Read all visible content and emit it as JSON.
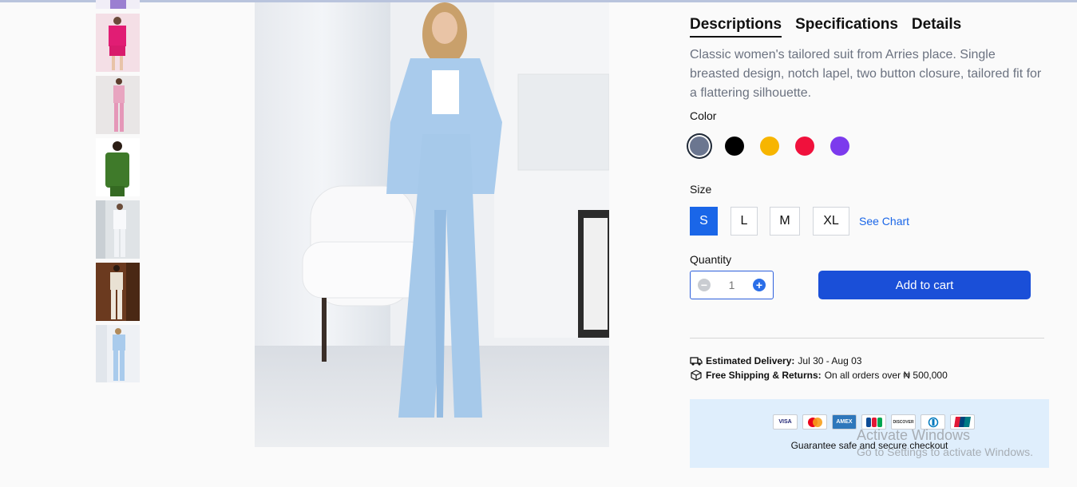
{
  "tabs": [
    {
      "label": "Descriptions",
      "active": true
    },
    {
      "label": "Specifications",
      "active": false
    },
    {
      "label": "Details",
      "active": false
    }
  ],
  "description": "Classic women's tailored suit from Arries place. Single breasted design, notch lapel, two button closure, tailored fit for a flattering silhouette.",
  "color_label": "Color",
  "colors": [
    {
      "name": "slate-gray",
      "hex": "#6b7690",
      "selected": true
    },
    {
      "name": "black",
      "hex": "#000000",
      "selected": false
    },
    {
      "name": "yellow",
      "hex": "#f7b500",
      "selected": false
    },
    {
      "name": "red",
      "hex": "#f0113c",
      "selected": false
    },
    {
      "name": "purple",
      "hex": "#7c3aed",
      "selected": false
    }
  ],
  "size_label": "Size",
  "sizes": [
    {
      "label": "S",
      "active": true
    },
    {
      "label": "L",
      "active": false
    },
    {
      "label": "M",
      "active": false
    },
    {
      "label": "XL",
      "active": false
    }
  ],
  "see_chart": "See Chart",
  "quantity_label": "Quantity",
  "quantity_value": "1",
  "add_to_cart": "Add to cart",
  "delivery": {
    "label": "Estimated Delivery:",
    "value": "Jul 30 - Aug 03"
  },
  "shipping": {
    "label": "Free Shipping & Returns:",
    "value": "On all orders over ₦ 500,000"
  },
  "payment_cards": [
    "VISA",
    "mastercard",
    "AMEX",
    "JCB",
    "DISCOVER",
    "Diners",
    "UnionPay"
  ],
  "secure_text": "Guarantee safe and secure checkout",
  "watermark": {
    "line1": "Activate Windows",
    "line2": "Go to Settings to activate Windows."
  },
  "thumbnails": [
    {
      "name": "purple-suit-thumbnail",
      "color": "#9b7fd1"
    },
    {
      "name": "pink-suit-thumbnail",
      "color": "#e11d74"
    },
    {
      "name": "light-pink-suit-thumbnail",
      "color": "#e8a5c0"
    },
    {
      "name": "green-suit-thumbnail",
      "color": "#3f7a2a"
    },
    {
      "name": "white-suit-thumbnail",
      "color": "#eef0f3"
    },
    {
      "name": "cream-suit-thumbnail",
      "color": "#e9e1d3"
    },
    {
      "name": "light-blue-suit-thumbnail",
      "color": "#a9cbec"
    }
  ],
  "colors_theme": {
    "accent": "#1a66e8",
    "cart": "#1a4fd8",
    "secure_bg": "#dfeefc"
  }
}
